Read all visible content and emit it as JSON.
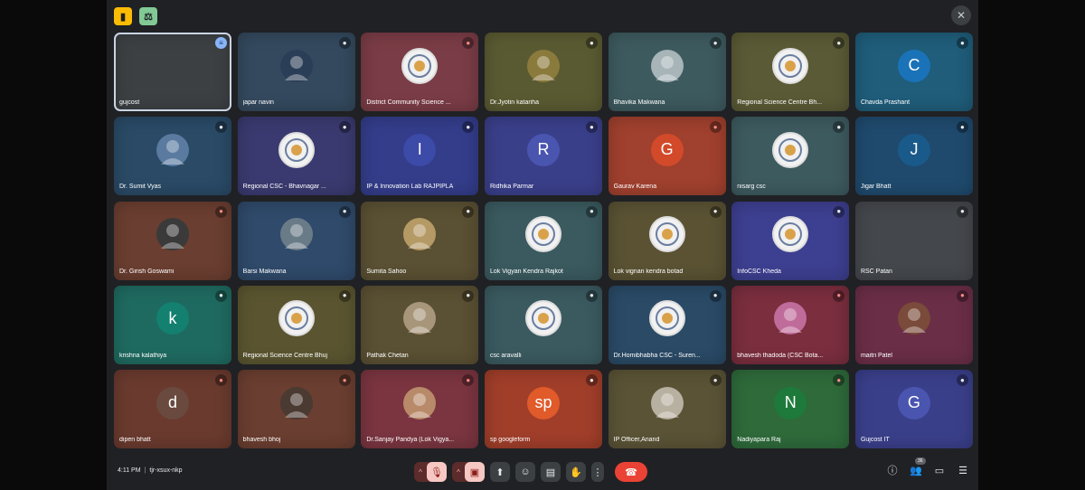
{
  "colors": {
    "accent": "#8ab4f8",
    "leave": "#ea4335",
    "muted": "#f28b82"
  },
  "top_bar": {
    "left_icons": [
      "meet-activities-icon",
      "meet-info-icon"
    ],
    "right_icon": "pin-off-icon"
  },
  "tiles": [
    {
      "name": "gujcost",
      "bg": "#3c4043",
      "avatar_type": "none",
      "initial": "",
      "avatar_color": "",
      "mic": "speaking",
      "active": true
    },
    {
      "name": "japar navin",
      "bg": "#34495e",
      "avatar_type": "photo",
      "initial": "",
      "avatar_color": "#2b3e57",
      "mic": "on"
    },
    {
      "name": "District Community Science ...",
      "bg": "#7a3c46",
      "avatar_type": "logo",
      "initial": "",
      "avatar_color": "",
      "mic": "muted"
    },
    {
      "name": "Dr.Jyotin katariha",
      "bg": "#5a5a32",
      "avatar_type": "photo",
      "initial": "",
      "avatar_color": "#8a7a3c",
      "mic": "on"
    },
    {
      "name": "Bhavika Makwana",
      "bg": "#3d5a5f",
      "avatar_type": "photo",
      "initial": "",
      "avatar_color": "#a7b4b8",
      "mic": "on"
    },
    {
      "name": "Regional Science Centre Bh...",
      "bg": "#5a5a36",
      "avatar_type": "logo",
      "initial": "",
      "avatar_color": "",
      "mic": "on"
    },
    {
      "name": "Chavda Prashant",
      "bg": "#1f5d7a",
      "avatar_type": "initial",
      "initial": "C",
      "avatar_color": "#1a73b8",
      "mic": "on"
    },
    {
      "name": "Dr. Sumit Vyas",
      "bg": "#2a4a66",
      "avatar_type": "photo",
      "initial": "",
      "avatar_color": "#5a7aa0",
      "mic": "on"
    },
    {
      "name": "Regional CSC - Bhavnagar ...",
      "bg": "#3a3a70",
      "avatar_type": "logo",
      "initial": "",
      "avatar_color": "",
      "mic": "on"
    },
    {
      "name": "IP & Innovation Lab RAJPIPLA",
      "bg": "#333d8a",
      "avatar_type": "initial",
      "initial": "I",
      "avatar_color": "#3c4aa8",
      "mic": "on"
    },
    {
      "name": "Ridhika Parmar",
      "bg": "#3a3f8a",
      "avatar_type": "initial",
      "initial": "R",
      "avatar_color": "#4a55b0",
      "mic": "on"
    },
    {
      "name": "Gaurav Karena",
      "bg": "#a0402e",
      "avatar_type": "initial",
      "initial": "G",
      "avatar_color": "#d24a2a",
      "mic": "muted"
    },
    {
      "name": "nisarg csc",
      "bg": "#3d5a5f",
      "avatar_type": "logo",
      "initial": "",
      "avatar_color": "",
      "mic": "on"
    },
    {
      "name": "Jigar Bhatt",
      "bg": "#1f4a6d",
      "avatar_type": "initial",
      "initial": "J",
      "avatar_color": "#1a5a8a",
      "mic": "on"
    },
    {
      "name": "Dr. Girish Goswami",
      "bg": "#6a3e30",
      "avatar_type": "photo",
      "initial": "",
      "avatar_color": "#3a3a3a",
      "mic": "muted"
    },
    {
      "name": "Barsi Makwana",
      "bg": "#2f4a6a",
      "avatar_type": "photo",
      "initial": "",
      "avatar_color": "#6a7b88",
      "mic": "on"
    },
    {
      "name": "Sumita Sahoo",
      "bg": "#5a5033",
      "avatar_type": "photo",
      "initial": "",
      "avatar_color": "#b59a66",
      "mic": "on"
    },
    {
      "name": "Lok Vigyan Kendra Rajkot",
      "bg": "#3a5a5f",
      "avatar_type": "logo",
      "initial": "",
      "avatar_color": "",
      "mic": "on"
    },
    {
      "name": "Lok vignan kendra botad",
      "bg": "#5a5233",
      "avatar_type": "logo",
      "initial": "",
      "avatar_color": "",
      "mic": "on"
    },
    {
      "name": "InfoCSC Kheda",
      "bg": "#3d3f90",
      "avatar_type": "logo",
      "initial": "",
      "avatar_color": "",
      "mic": "on"
    },
    {
      "name": "RSC Patan",
      "bg": "#44474c",
      "avatar_type": "none",
      "initial": "",
      "avatar_color": "",
      "mic": "on"
    },
    {
      "name": "krishna kalathiya",
      "bg": "#1f6a60",
      "avatar_type": "initial",
      "initial": "k",
      "avatar_color": "#138070",
      "mic": "on"
    },
    {
      "name": "Regional Science Centre Bhuj",
      "bg": "#5a5530",
      "avatar_type": "logo",
      "initial": "",
      "avatar_color": "",
      "mic": "on"
    },
    {
      "name": "Pathak Chetan",
      "bg": "#5a5033",
      "avatar_type": "photo",
      "initial": "",
      "avatar_color": "#a8967a",
      "mic": "on"
    },
    {
      "name": "csc aravalli",
      "bg": "#3a5a60",
      "avatar_type": "logo",
      "initial": "",
      "avatar_color": "",
      "mic": "on"
    },
    {
      "name": "Dr.Homibhabha CSC - Suren...",
      "bg": "#2a4a66",
      "avatar_type": "logo",
      "initial": "",
      "avatar_color": "",
      "mic": "on"
    },
    {
      "name": "bhavesh thadoda (CSC Bota...",
      "bg": "#7a2e3e",
      "avatar_type": "photo",
      "initial": "",
      "avatar_color": "#c06c9a",
      "mic": "muted"
    },
    {
      "name": "maitri Patel",
      "bg": "#6a2e46",
      "avatar_type": "photo",
      "initial": "",
      "avatar_color": "#7a4a3a",
      "mic": "muted"
    },
    {
      "name": "dipen bhatt",
      "bg": "#6a3a2e",
      "avatar_type": "initial",
      "initial": "d",
      "avatar_color": "#6a4a3e",
      "mic": "muted"
    },
    {
      "name": "bhavesh bhoj",
      "bg": "#6a3e30",
      "avatar_type": "photo",
      "initial": "",
      "avatar_color": "#4a3a32",
      "mic": "muted"
    },
    {
      "name": "Dr.Sanjay Pandya (Lok Vigya...",
      "bg": "#7a3540",
      "avatar_type": "photo",
      "initial": "",
      "avatar_color": "#b88a6a",
      "mic": "muted"
    },
    {
      "name": "sp googleform",
      "bg": "#a03e2a",
      "avatar_type": "initial",
      "initial": "sp",
      "avatar_color": "#e05a2a",
      "mic": "on"
    },
    {
      "name": "IP Officer,Anand",
      "bg": "#5a5336",
      "avatar_type": "photo",
      "initial": "",
      "avatar_color": "#b8b0a0",
      "mic": "on"
    },
    {
      "name": "Nadiyapara Raj",
      "bg": "#2e6a3a",
      "avatar_type": "initial",
      "initial": "N",
      "avatar_color": "#1e7a3a",
      "mic": "muted"
    },
    {
      "name": "Gujcost IT",
      "bg": "#3a3f8a",
      "avatar_type": "initial",
      "initial": "G",
      "avatar_color": "#4a55b0",
      "mic": "on"
    }
  ],
  "bottom": {
    "time": "4:11 PM",
    "meeting_code": "tjr-xsux-nkp",
    "participant_count": "36"
  }
}
